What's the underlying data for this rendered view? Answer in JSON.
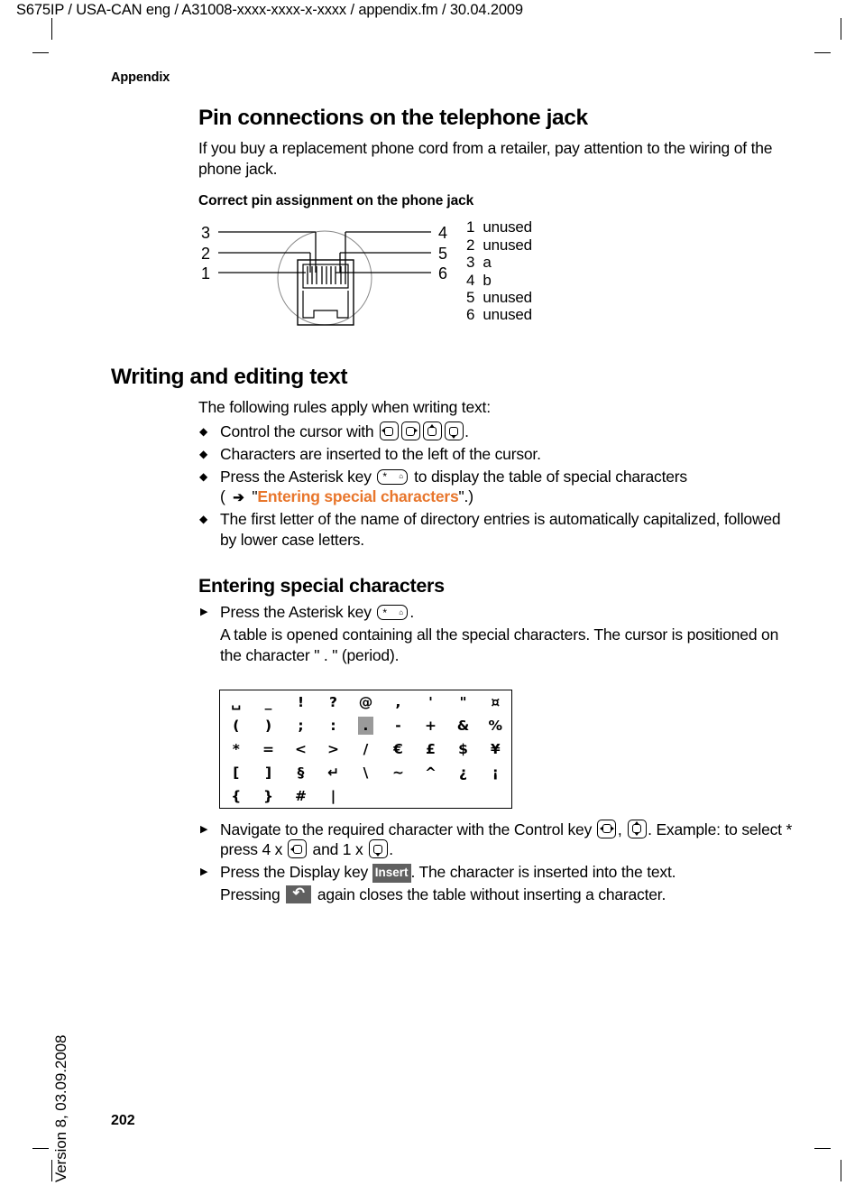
{
  "production_header": "S675IP  / USA-CAN eng / A31008-xxxx-xxxx-x-xxxx / appendix.fm / 30.04.2009",
  "version_note": "Version 8, 03.09.2008",
  "running_head": "Appendix",
  "page_number": "202",
  "colors": {
    "xref_orange": "#E8762C",
    "softkey_gray": "#606060",
    "cursor_gray": "#9a9a9a"
  },
  "sections": {
    "pin_connections": {
      "title": "Pin connections on the telephone jack",
      "intro": "If you buy a replacement phone cord from a retailer, pay attention to the wiring of the phone jack.",
      "figure_caption": "Correct pin assignment on the phone jack",
      "left_pin_labels": [
        "3",
        "2",
        "1"
      ],
      "right_pin_labels": [
        "4",
        "5",
        "6"
      ],
      "legend": [
        {
          "pin": "1",
          "function": "unused"
        },
        {
          "pin": "2",
          "function": "unused"
        },
        {
          "pin": "3",
          "function": "a"
        },
        {
          "pin": "4",
          "function": "b"
        },
        {
          "pin": "5",
          "function": "unused"
        },
        {
          "pin": "6",
          "function": "unused"
        }
      ]
    },
    "writing_editing": {
      "title": "Writing and editing text",
      "intro": "The following rules apply when writing text:",
      "bullets": {
        "b1_pre": "Control the cursor with ",
        "b1_post": ".",
        "b2": "Characters are inserted to the left of the cursor.",
        "b3_pre": "Press the Asterisk key ",
        "b3_post": " to display the table of special characters",
        "b3_xref_open": "( ",
        "b3_xref_arrow": "➔",
        "b3_xref_quote_open": " \"",
        "b3_xref_link": "Entering special characters",
        "b3_xref_close": "\".)",
        "b4": "The first letter of the name of directory entries is automatically capitalized, followed by lower case letters."
      }
    },
    "special_characters": {
      "title": "Entering special characters",
      "step1_pre": "Press the Asterisk key ",
      "step1_post": ".",
      "step1_detail": "A table is opened containing all the special characters. The cursor is positioned on the character \" . \" (period).",
      "step2_pre": "Navigate to the required character with the Control key ",
      "step2_mid": ", ",
      "step2_post": ". Example: to select * press 4 x ",
      "step2_and": " and 1 x ",
      "step2_end": ".",
      "step3_pre": "Press the Display key ",
      "step3_key_label": "Insert",
      "step3_post": ". The character is inserted into the text.",
      "step4_pre": "Pressing ",
      "step4_post": " again closes the table without inserting a character.",
      "table": {
        "columns": 9,
        "rows": [
          [
            "␣",
            "_",
            "!",
            "?",
            "@",
            ",",
            "'",
            "\"",
            "¤"
          ],
          [
            "(",
            ")",
            ";",
            ":",
            ".",
            "-",
            "+",
            "&",
            "%"
          ],
          [
            "*",
            "=",
            "<",
            ">",
            "/",
            "€",
            "£",
            "$",
            "¥"
          ],
          [
            "[",
            "]",
            "§",
            "↵",
            "\\",
            "~",
            "^",
            "¿",
            "¡"
          ],
          [
            "{",
            "}",
            "#",
            "|",
            "",
            "",
            "",
            "",
            ""
          ]
        ],
        "selected_cell": {
          "row": 1,
          "col": 4,
          "char": "."
        }
      }
    }
  },
  "icons": {
    "key_left": "cursor-left-key",
    "key_right": "cursor-right-key",
    "key_up": "cursor-up-key",
    "key_down": "cursor-down-key",
    "key_star": "asterisk-key",
    "key_horizontal": "cursor-horizontal-key",
    "key_vertical": "cursor-vertical-key",
    "key_back": "back-softkey",
    "star_glyph": "*",
    "bell_glyph": "⌂",
    "back_glyph": "↶"
  }
}
